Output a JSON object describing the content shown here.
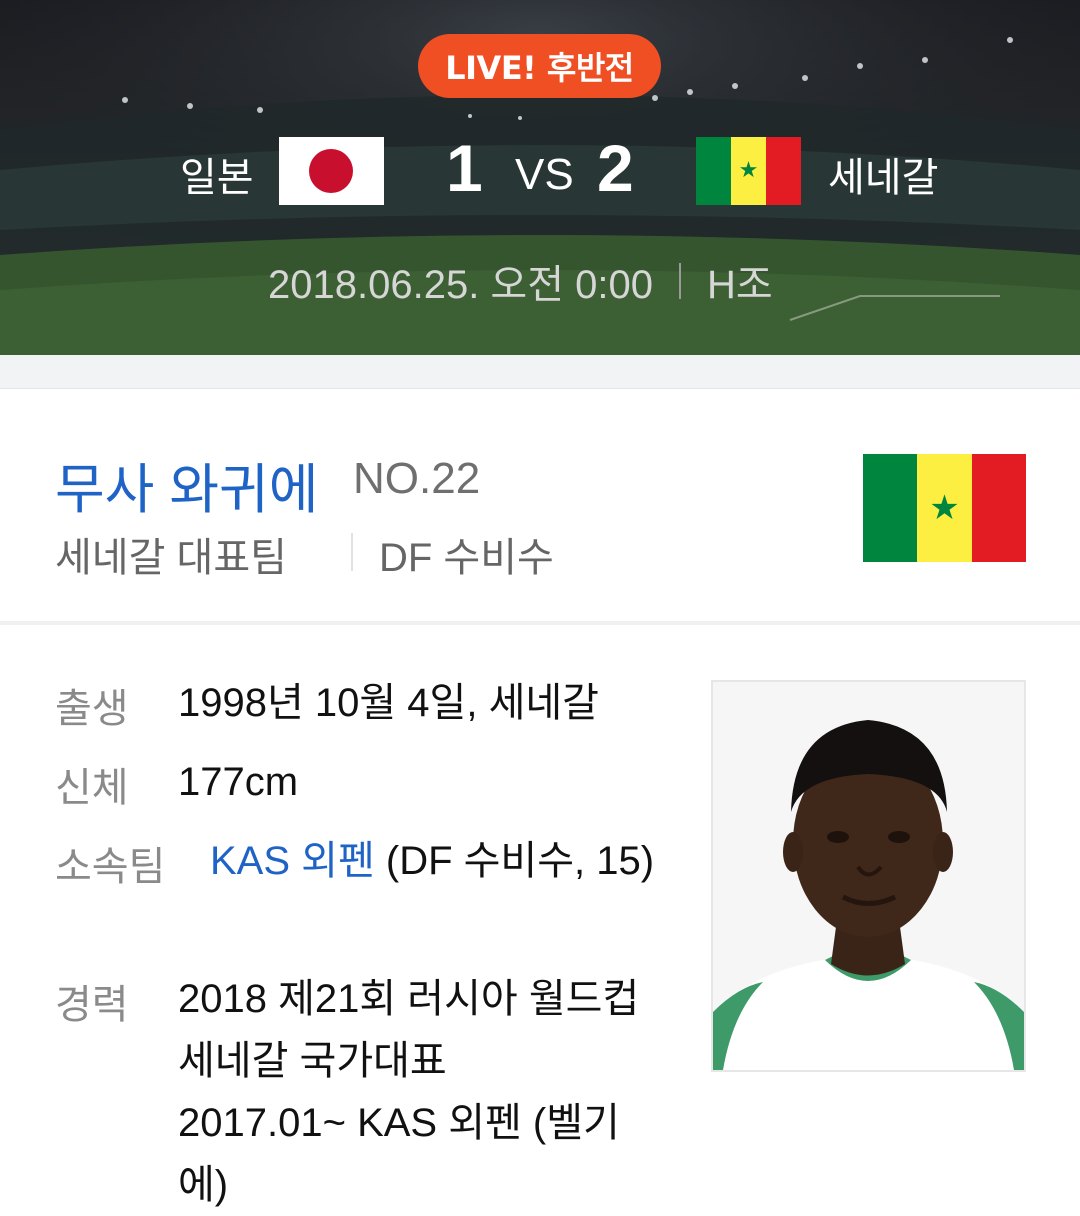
{
  "match": {
    "status_badge": "LIVE! 후반전",
    "home_team": "일본",
    "away_team": "세네갈",
    "home_score": "1",
    "vs_label": "VS",
    "away_score": "2",
    "datetime": "2018.06.25. 오전 0:00",
    "group": "H조",
    "colors": {
      "badge": "#f04e23"
    }
  },
  "player": {
    "name": "무사 와귀에",
    "number": "NO.22",
    "team": "세네갈 대표팀",
    "position": "DF 수비수",
    "flag_icon": "senegal-flag-icon",
    "info": {
      "birth_label": "출생",
      "birth_value": "1998년 10월 4일, 세네갈",
      "body_label": "신체",
      "body_value": "177cm",
      "club_label": "소속팀",
      "club_name": "KAS 외펜",
      "club_detail": " (DF 수비수, 15)",
      "career_label": "경력",
      "career_line1": "2018 제21회 러시아 월드컵 세네갈 국가대표",
      "career_line2": "2017.01~ KAS 외펜 (벨기에)"
    },
    "link_color": "#1f63c6"
  }
}
